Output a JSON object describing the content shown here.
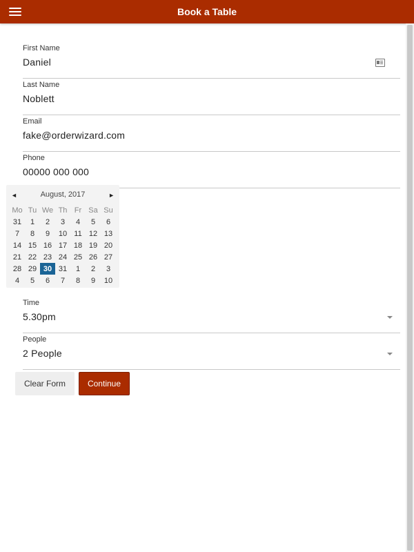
{
  "header": {
    "title": "Book a Table"
  },
  "form": {
    "first_name": {
      "label": "First Name",
      "value": "Daniel"
    },
    "last_name": {
      "label": "Last Name",
      "value": "Noblett"
    },
    "email": {
      "label": "Email",
      "value": "fake@orderwizard.com"
    },
    "phone": {
      "label": "Phone",
      "value": "00000 000 000"
    },
    "time": {
      "label": "Time",
      "value": "5.30pm"
    },
    "people": {
      "label": "People",
      "value": "2 People"
    }
  },
  "calendar": {
    "prev_symbol": "◄",
    "next_symbol": "►",
    "month_label": "August, 2017",
    "weekdays": [
      "Mo",
      "Tu",
      "We",
      "Th",
      "Fr",
      "Sa",
      "Su"
    ],
    "weeks": [
      [
        "31",
        "1",
        "2",
        "3",
        "4",
        "5",
        "6"
      ],
      [
        "7",
        "8",
        "9",
        "10",
        "11",
        "12",
        "13"
      ],
      [
        "14",
        "15",
        "16",
        "17",
        "18",
        "19",
        "20"
      ],
      [
        "21",
        "22",
        "23",
        "24",
        "25",
        "26",
        "27"
      ],
      [
        "28",
        "29",
        "30",
        "31",
        "1",
        "2",
        "3"
      ],
      [
        "4",
        "5",
        "6",
        "7",
        "8",
        "9",
        "10"
      ]
    ],
    "selected_day": "30",
    "selected_color": "#1a6496"
  },
  "buttons": {
    "clear_label": "Clear Form",
    "continue_label": "Continue"
  },
  "colors": {
    "brand": "#aa2c00",
    "selected": "#1a6496"
  },
  "icons": {
    "menu": "hamburger-menu-icon",
    "contact_card": "contact-card-icon",
    "dropdown": "dropdown-caret-icon"
  }
}
